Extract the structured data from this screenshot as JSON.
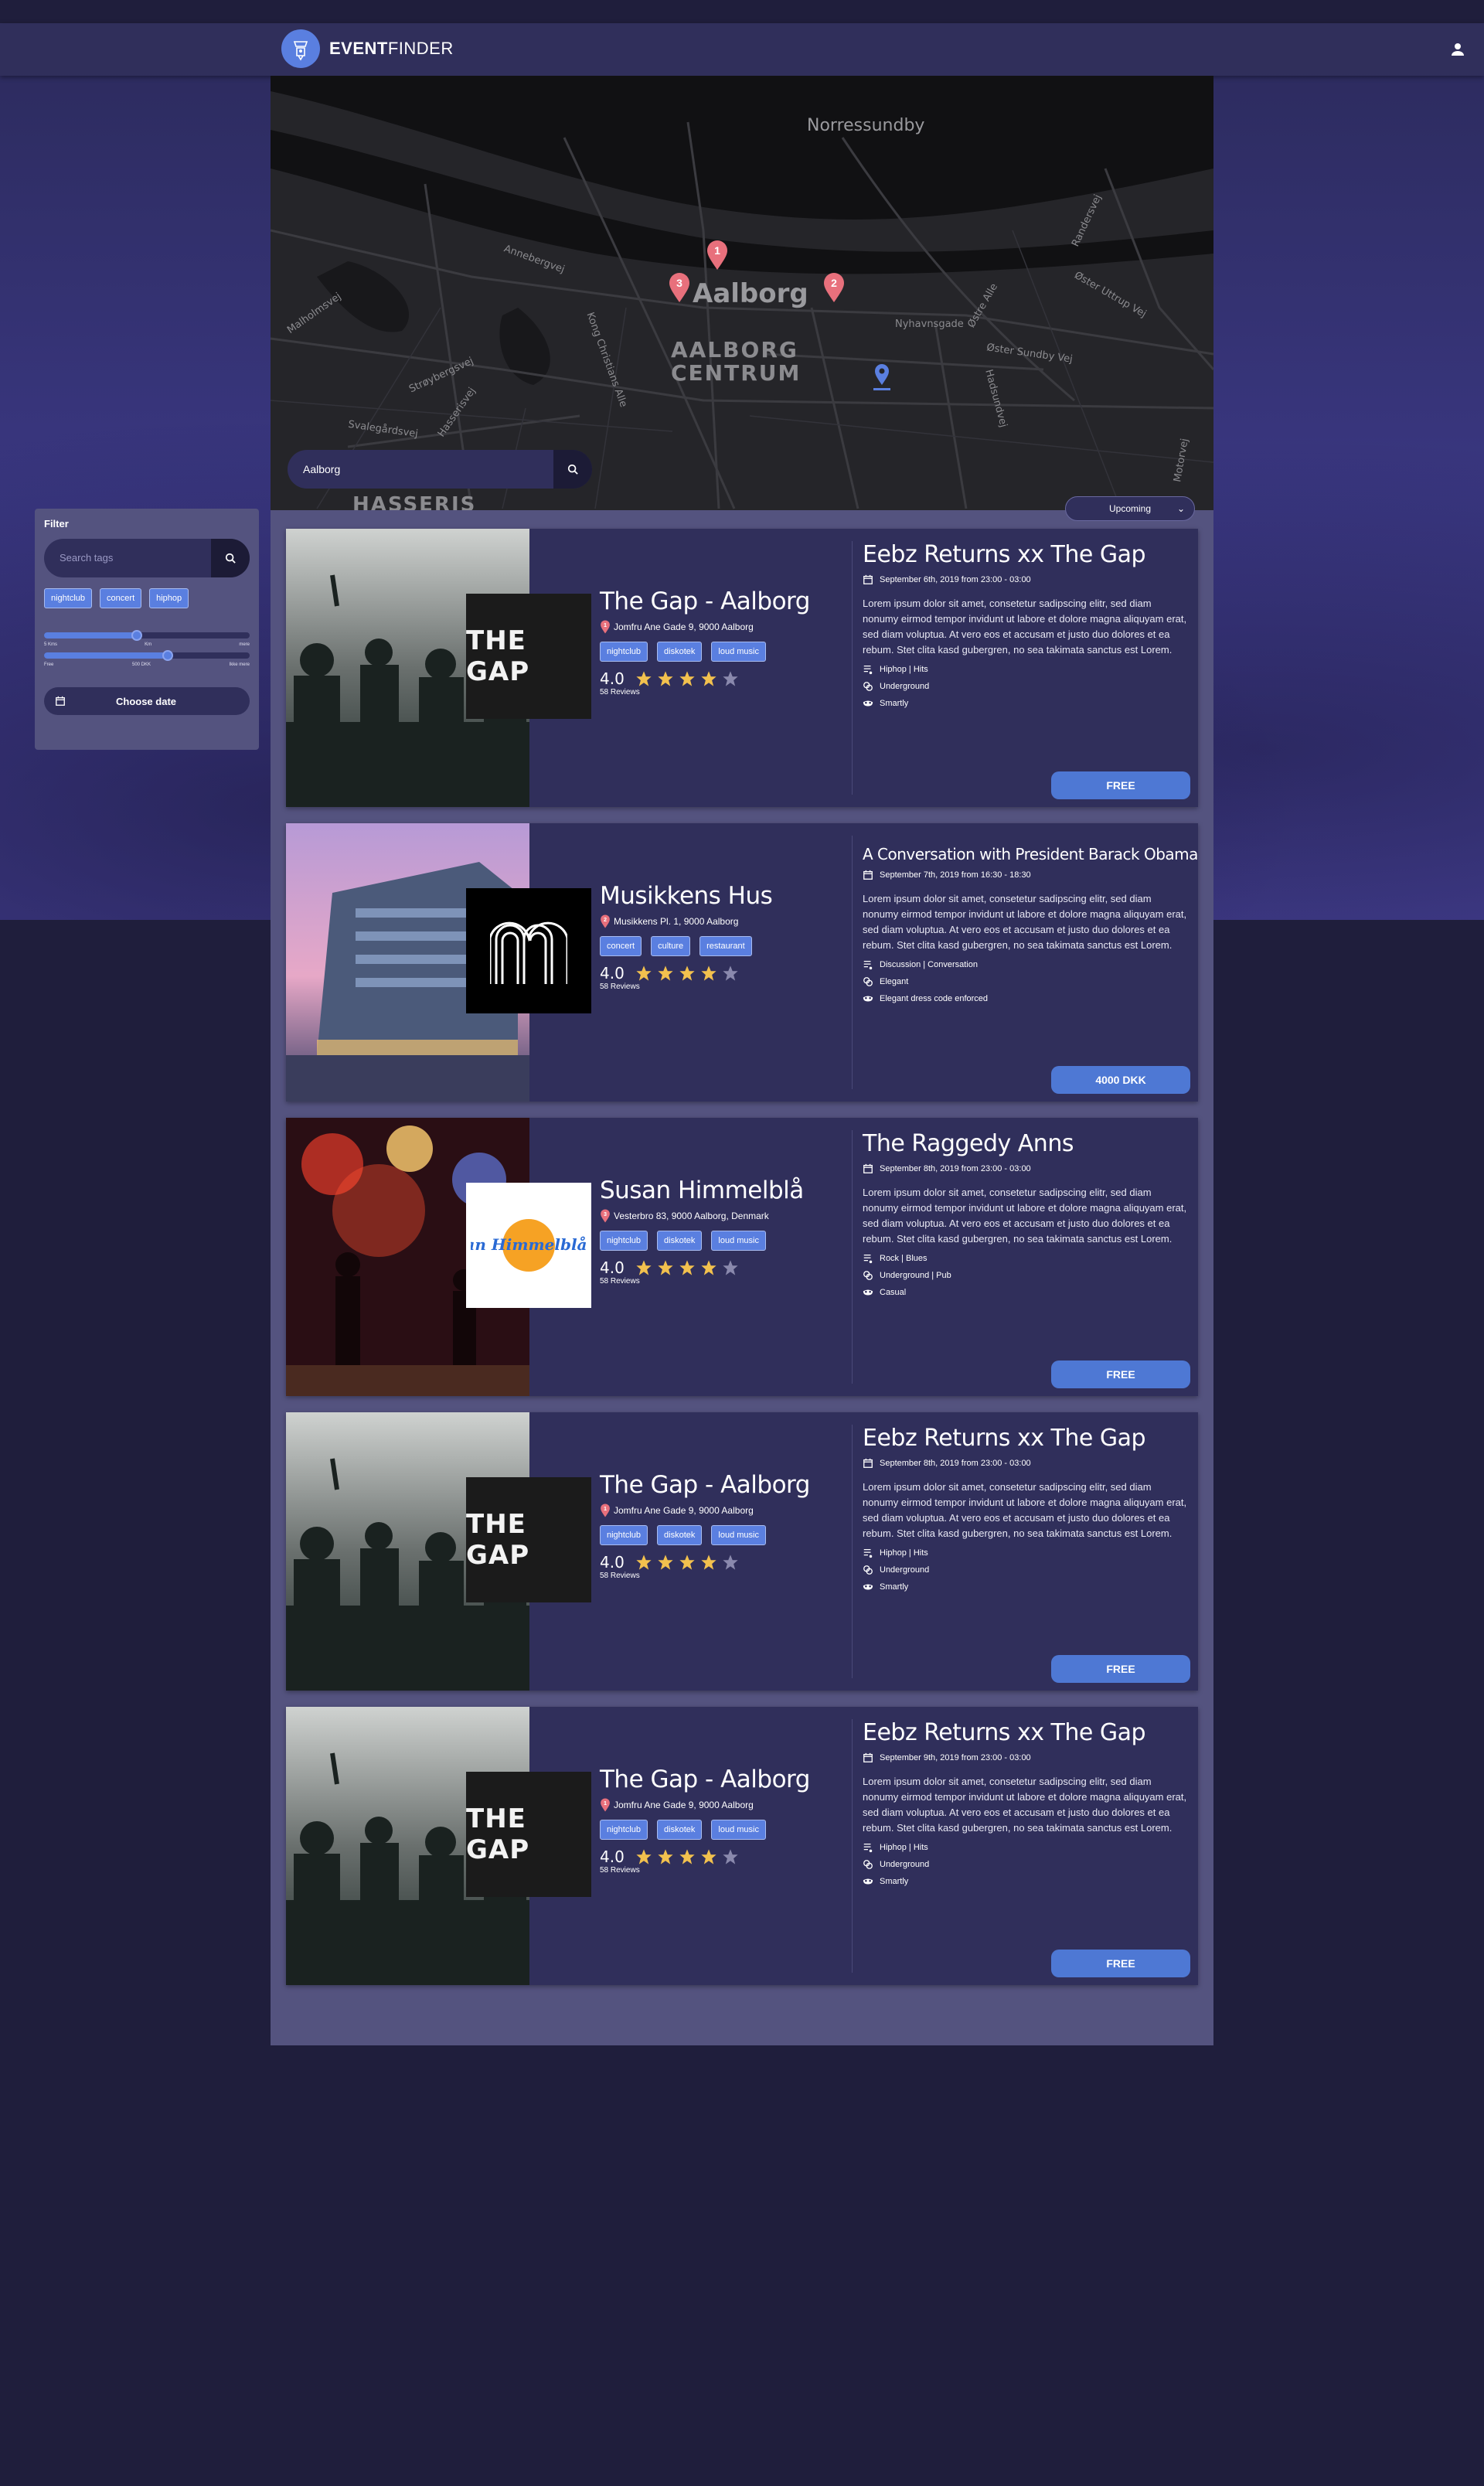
{
  "app": {
    "brand_bold": "EVENT",
    "brand_light": "FINDER"
  },
  "map": {
    "search_value": "Aalborg",
    "labels": {
      "north": "Norressundby",
      "city": "Aalborg",
      "centrum": "AALBORG\nCENTRUM",
      "hasseris": "HASSERIS",
      "streets": [
        "Malholmsvej",
        "Annebergvej",
        "Kong Christians Alle",
        "Strøybergsvej",
        "Hasserisvej",
        "Svalegårdsvej",
        "Nyhavnsgade",
        "Østre Alle",
        "Øster Sundby Vej",
        "Øster Uttrup Vej",
        "Hadsundvej",
        "Motorvej",
        "Randersvej"
      ]
    },
    "pins": [
      "1",
      "2",
      "3"
    ]
  },
  "sort": {
    "selected": "Upcoming"
  },
  "filter": {
    "title": "Filter",
    "search_placeholder": "Search tags",
    "tags": [
      "nightclub",
      "concert",
      "hiphop"
    ],
    "slider1_labels": [
      "5 Kms",
      "Km",
      "mere"
    ],
    "slider2_labels": [
      "Free",
      "500 DKK",
      "Ikke mere"
    ],
    "slider1_value": 0.45,
    "slider2_value": 0.6,
    "date_button": "Choose date"
  },
  "events": [
    {
      "venue": "The Gap - Aalborg",
      "pin": "1",
      "address": "Jomfru Ane Gade 9, 9000 Aalborg",
      "tags": [
        "nightclub",
        "diskotek",
        "loud music"
      ],
      "rating": "4.0",
      "stars": 4,
      "reviews": "58 Reviews",
      "logo": "THE GAP",
      "photo": "crowd",
      "title": "Eebz Returns xx The Gap",
      "title_small": false,
      "date": "September 6th, 2019 from 23:00 - 03:00",
      "description": "Lorem ipsum dolor sit amet, consetetur sadipscing elitr, sed diam nonumy eirmod tempor invidunt ut labore et dolore magna aliquyam erat, sed diam voluptua. At vero eos et accusam et justo duo dolores et ea rebum. Stet clita kasd gubergren, no sea takimata sanctus est Lorem.",
      "genre": "Hiphop | Hits",
      "vibe": "Underground",
      "dress": "Smartly",
      "price": "FREE"
    },
    {
      "venue": "Musikkens Hus",
      "pin": "2",
      "address": "Musikkens Pl. 1, 9000 Aalborg",
      "tags": [
        "concert",
        "culture",
        "restaurant"
      ],
      "rating": "4.0",
      "stars": 4,
      "reviews": "58 Reviews",
      "logo": "M",
      "photo": "building",
      "title": "A Conversation with President Barack Obama",
      "title_small": true,
      "date": "September 7th, 2019 from 16:30 - 18:30",
      "description": "Lorem ipsum dolor sit amet, consetetur sadipscing elitr, sed diam nonumy eirmod tempor invidunt ut labore et dolore magna aliquyam erat, sed diam voluptua. At vero eos et accusam et justo duo dolores et ea rebum. Stet clita kasd gubergren, no sea takimata sanctus est Lorem.",
      "genre": "Discussion | Conversation",
      "vibe": "Elegant",
      "dress": "Elegant dress code enforced",
      "price": "4000 DKK"
    },
    {
      "venue": "Susan Himmelblå",
      "pin": "3",
      "address": "Vesterbro 83, 9000 Aalborg, Denmark",
      "tags": [
        "nightclub",
        "diskotek",
        "loud music"
      ],
      "rating": "4.0",
      "stars": 4,
      "reviews": "58 Reviews",
      "logo": "Susan Himmelblå Bar",
      "photo": "concert",
      "title": "The Raggedy Anns",
      "title_small": false,
      "date": "September 8th, 2019 from 23:00 - 03:00",
      "description": "Lorem ipsum dolor sit amet, consetetur sadipscing elitr, sed diam nonumy eirmod tempor invidunt ut labore et dolore magna aliquyam erat, sed diam voluptua. At vero eos et accusam et justo duo dolores et ea rebum. Stet clita kasd gubergren, no sea takimata sanctus est Lorem.",
      "genre": "Rock | Blues",
      "vibe": "Underground | Pub",
      "dress": "Casual",
      "price": "FREE"
    },
    {
      "venue": "The Gap - Aalborg",
      "pin": "1",
      "address": "Jomfru Ane Gade 9, 9000 Aalborg",
      "tags": [
        "nightclub",
        "diskotek",
        "loud music"
      ],
      "rating": "4.0",
      "stars": 4,
      "reviews": "58 Reviews",
      "logo": "THE GAP",
      "photo": "crowd",
      "title": "Eebz Returns xx The Gap",
      "title_small": false,
      "date": "September 8th, 2019 from 23:00 - 03:00",
      "description": "Lorem ipsum dolor sit amet, consetetur sadipscing elitr, sed diam nonumy eirmod tempor invidunt ut labore et dolore magna aliquyam erat, sed diam voluptua. At vero eos et accusam et justo duo dolores et ea rebum. Stet clita kasd gubergren, no sea takimata sanctus est Lorem.",
      "genre": "Hiphop | Hits",
      "vibe": "Underground",
      "dress": "Smartly",
      "price": "FREE"
    },
    {
      "venue": "The Gap - Aalborg",
      "pin": "1",
      "address": "Jomfru Ane Gade 9, 9000 Aalborg",
      "tags": [
        "nightclub",
        "diskotek",
        "loud music"
      ],
      "rating": "4.0",
      "stars": 4,
      "reviews": "58 Reviews",
      "logo": "THE GAP",
      "photo": "crowd",
      "title": "Eebz Returns xx The Gap",
      "title_small": false,
      "date": "September 9th, 2019 from 23:00 - 03:00",
      "description": "Lorem ipsum dolor sit amet, consetetur sadipscing elitr, sed diam nonumy eirmod tempor invidunt ut labore et dolore magna aliquyam erat, sed diam voluptua. At vero eos et accusam et justo duo dolores et ea rebum. Stet clita kasd gubergren, no sea takimata sanctus est Lorem.",
      "genre": "Hiphop | Hits",
      "vibe": "Underground",
      "dress": "Smartly",
      "price": "FREE"
    }
  ],
  "colors": {
    "accent": "#5a7fe0",
    "card": "#302f5b",
    "pin": "#e8707c",
    "star": "#f2c14e",
    "star_empty": "#8a89ad"
  }
}
